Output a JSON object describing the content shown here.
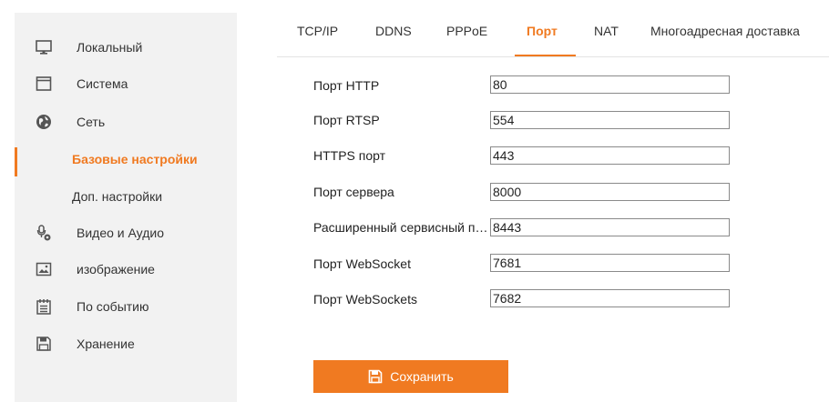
{
  "sidebar": {
    "items": [
      {
        "label": "Локальный",
        "icon": "monitor-icon"
      },
      {
        "label": "Система",
        "icon": "window-icon"
      },
      {
        "label": "Сеть",
        "icon": "globe-icon"
      },
      {
        "label": "Базовые настройки",
        "sub": true,
        "active": true
      },
      {
        "label": "Доп. настройки",
        "sub": true
      },
      {
        "label": "Видео и Аудио",
        "icon": "mic-camera-icon"
      },
      {
        "label": "изображение",
        "icon": "image-icon"
      },
      {
        "label": "По событию",
        "icon": "calendar-list-icon"
      },
      {
        "label": "Хранение",
        "icon": "floppy-icon"
      }
    ]
  },
  "tabs": [
    {
      "label": "TCP/IP"
    },
    {
      "label": "DDNS"
    },
    {
      "label": "PPPoE"
    },
    {
      "label": "Порт",
      "active": true
    },
    {
      "label": "NAT"
    },
    {
      "label": "Многоадресная доставка"
    }
  ],
  "form": {
    "rows": [
      {
        "label": "Порт HTTP",
        "value": "80"
      },
      {
        "label": "Порт RTSP",
        "value": "554"
      },
      {
        "label": "HTTPS порт",
        "value": "443"
      },
      {
        "label": "Порт сервера",
        "value": "8000"
      },
      {
        "label": "Расширенный сервисный порт",
        "value": "8443"
      },
      {
        "label": "Порт WebSocket",
        "value": "7681"
      },
      {
        "label": "Порт WebSockets",
        "value": "7682"
      }
    ]
  },
  "save_button": {
    "label": "Сохранить",
    "icon": "floppy-icon"
  },
  "colors": {
    "accent": "#f07a21",
    "sidebar_bg": "#f2f2f2"
  }
}
